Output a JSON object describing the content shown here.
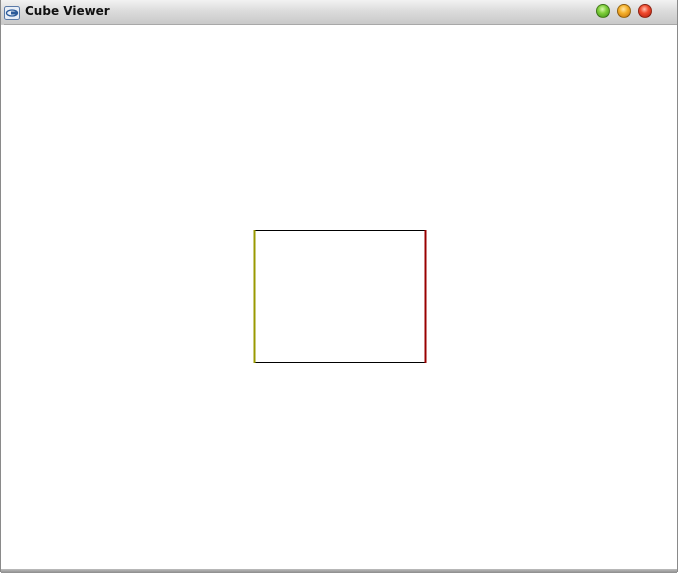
{
  "window": {
    "title": "Cube Viewer",
    "app_icon": "app-logo-icon",
    "buttons": {
      "maximize_icon": "green-circle-icon",
      "minimize_icon": "orange-circle-icon",
      "close_icon": "red-circle-icon"
    }
  },
  "scene": {
    "object": "cube-wireframe",
    "edge_colors": {
      "top": "#000000",
      "bottom": "#000000",
      "left": "#999900",
      "right": "#990000"
    }
  }
}
